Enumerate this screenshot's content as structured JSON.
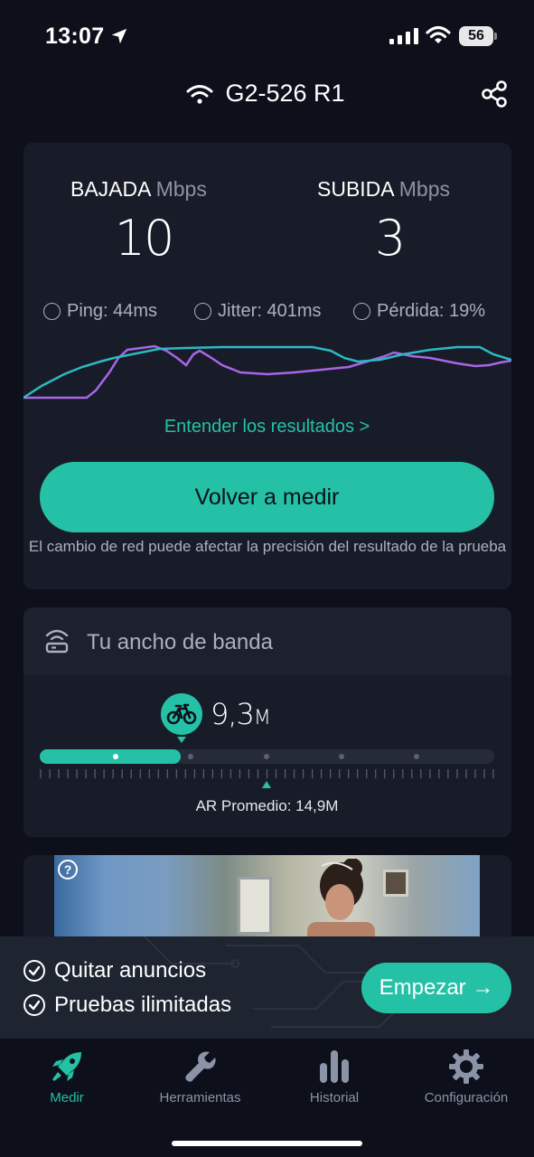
{
  "status_bar": {
    "time": "13:07",
    "battery": "56"
  },
  "header": {
    "network_name": "G2-526 R1"
  },
  "results": {
    "download_label": "BAJADA",
    "download_unit": "Mbps",
    "download_value": "10",
    "upload_label": "SUBIDA",
    "upload_unit": "Mbps",
    "upload_value": "3",
    "ping": "Ping: 44ms",
    "jitter": "Jitter: 401ms",
    "loss": "Pérdida: 19%",
    "understand_link": "Entender los resultados >",
    "retest_button": "Volver a medir",
    "note": "El cambio de red puede afectar la precisión del resultado de la prueba"
  },
  "bandwidth": {
    "title": "Tu ancho de banda",
    "value": "9,3",
    "value_suffix": "M",
    "level_fraction": 0.31,
    "average_text": "AR Promedio: 14,9M"
  },
  "ad": {
    "help": "?"
  },
  "promo": {
    "line1": "Quitar anuncios",
    "line2": "Pruebas ilimitadas",
    "button": "Empezar →"
  },
  "tabs": [
    {
      "label": "Medir",
      "icon": "rocket-icon",
      "active": true
    },
    {
      "label": "Herramientas",
      "icon": "wrench-icon",
      "active": false
    },
    {
      "label": "Historial",
      "icon": "bar-chart-icon",
      "active": false
    },
    {
      "label": "Configuración",
      "icon": "gear-icon",
      "active": false
    }
  ],
  "colors": {
    "accent": "#25c1a6",
    "download_line": "#2bb9c4",
    "upload_line": "#a866e6",
    "background": "#0d101a",
    "card": "#181c28"
  }
}
